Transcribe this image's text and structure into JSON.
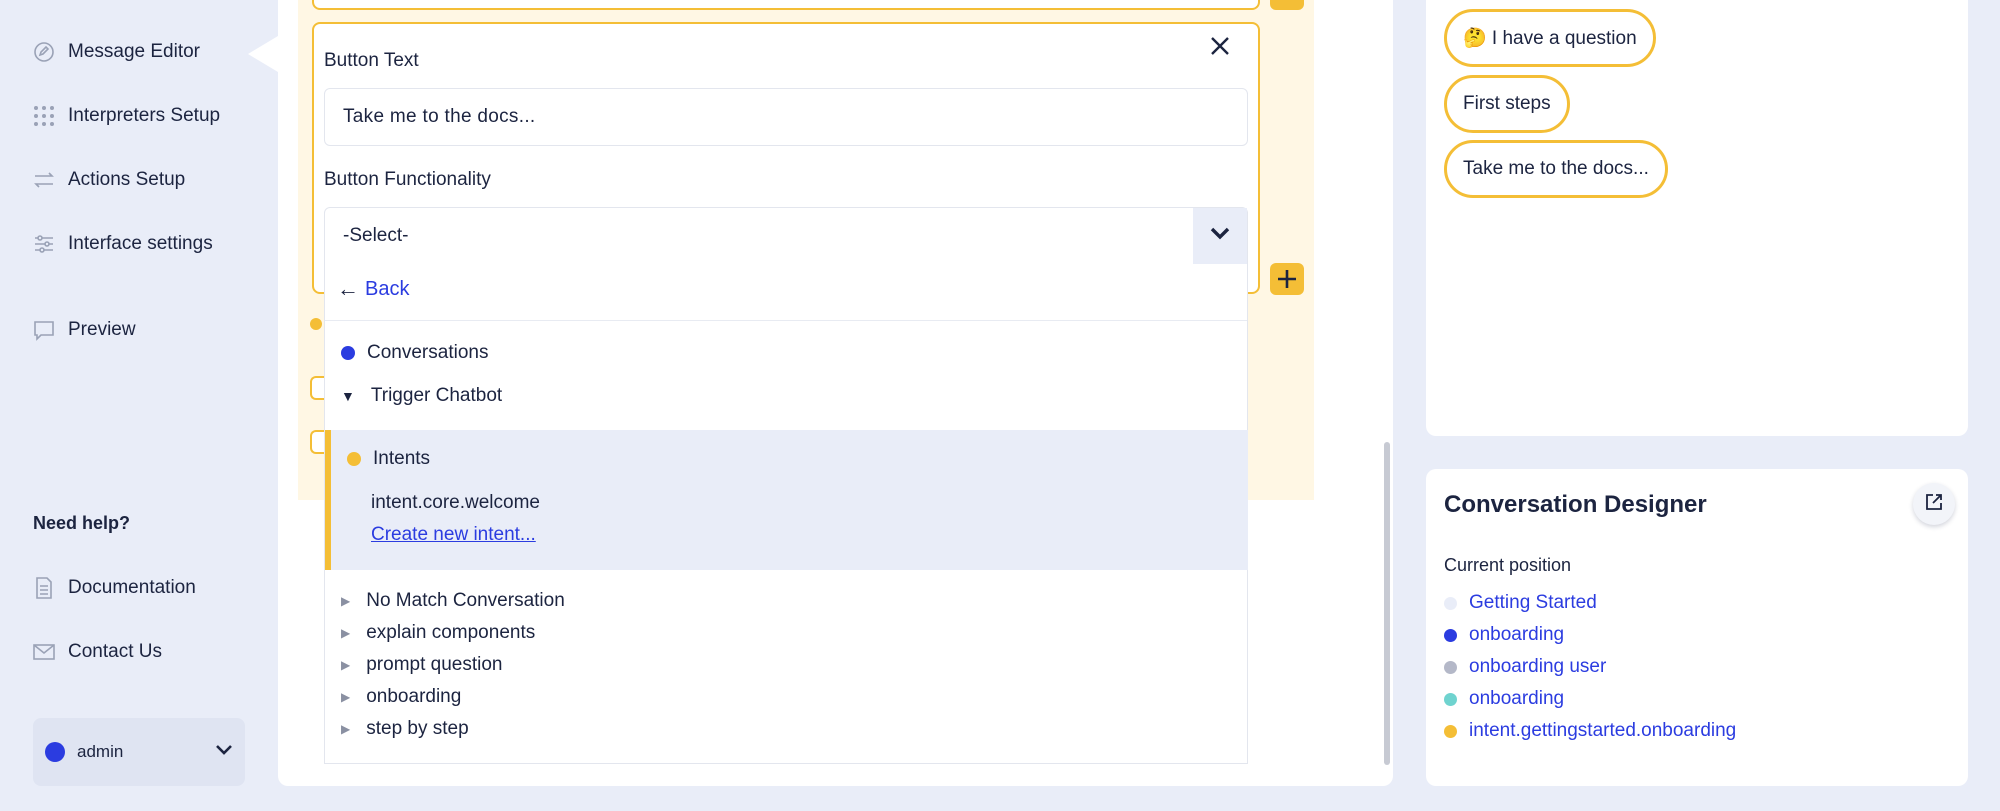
{
  "sidebar": {
    "items": [
      {
        "label": "Message Editor",
        "icon": "message-edit-icon"
      },
      {
        "label": "Interpreters Setup",
        "icon": "grid-dots-icon"
      },
      {
        "label": "Actions Setup",
        "icon": "arrows-swap-icon"
      },
      {
        "label": "Interface settings",
        "icon": "sliders-icon"
      },
      {
        "label": "Preview",
        "icon": "chat-bubble-icon"
      }
    ],
    "help_title": "Need help?",
    "help_items": [
      {
        "label": "Documentation",
        "icon": "document-icon"
      },
      {
        "label": "Contact Us",
        "icon": "envelope-icon"
      }
    ],
    "user": {
      "name": "admin"
    }
  },
  "editor": {
    "button_text_label": "Button Text",
    "button_text_value": "Take me to the docs...",
    "button_functionality_label": "Button Functionality",
    "select_value": "-Select-",
    "dropdown": {
      "back_label": "Back",
      "conversations_label": "Conversations",
      "trigger_chatbot_label": "Trigger Chatbot",
      "intents_label": "Intents",
      "intent_option": "intent.core.welcome",
      "create_intent_label": "Create new intent...",
      "collapsed_items": [
        "No Match Conversation",
        "explain components",
        "prompt question",
        "onboarding",
        "step by step"
      ]
    }
  },
  "preview": {
    "chips": [
      "🤔 I have a question",
      "First steps",
      "Take me to the docs..."
    ]
  },
  "designer": {
    "title": "Conversation Designer",
    "current_position_label": "Current position",
    "positions": [
      {
        "label": "Getting Started",
        "color": "#e9edf8"
      },
      {
        "label": "onboarding",
        "color": "#2b3ce0"
      },
      {
        "label": "onboarding user",
        "color": "#b4b8c8"
      },
      {
        "label": "onboarding",
        "color": "#6fd3cf"
      },
      {
        "label": "intent.gettingstarted.onboarding",
        "color": "#f4be36"
      }
    ]
  },
  "colors": {
    "accent": "#f4be36",
    "link": "#2b3ce0",
    "background": "#e9edf8"
  }
}
